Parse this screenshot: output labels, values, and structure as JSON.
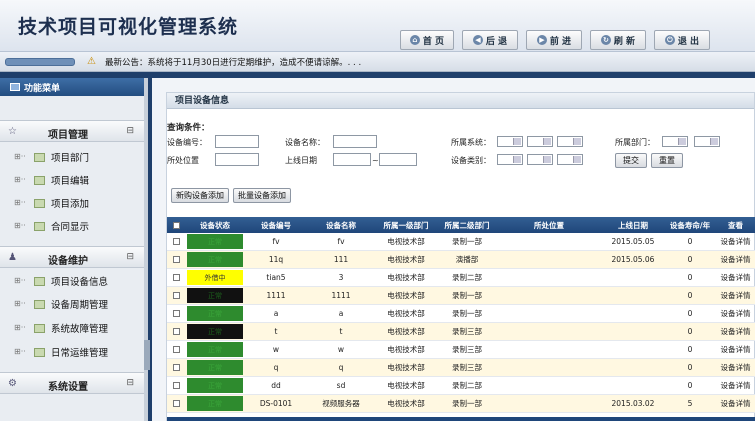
{
  "header": {
    "title": "技术项目可视化管理系统"
  },
  "nav": [
    {
      "label": "首 页",
      "icon": "home-icon",
      "glyph": "⌂"
    },
    {
      "label": "后 退",
      "icon": "back-icon",
      "glyph": "◀"
    },
    {
      "label": "前 进",
      "icon": "forward-icon",
      "glyph": "▶"
    },
    {
      "label": "刷 新",
      "icon": "refresh-icon",
      "glyph": "↻"
    },
    {
      "label": "退 出",
      "icon": "power-icon",
      "glyph": "⏻"
    }
  ],
  "notice": {
    "text": "最新公告：系统将于11月30日进行定期维护，造成不便请谅解。. . ."
  },
  "sidebar": {
    "header": "功能菜单",
    "sections": [
      {
        "title": "项目管理",
        "items": [
          "项目部门",
          "项目编辑",
          "项目添加",
          "合同显示"
        ]
      },
      {
        "title": "设备维护",
        "items": [
          "项目设备信息",
          "设备周期管理",
          "系统故障管理",
          "日常运维管理"
        ]
      },
      {
        "title": "系统设置",
        "items": []
      }
    ]
  },
  "panel": {
    "title": "项目设备信息"
  },
  "query": {
    "heading": "查询条件：",
    "labels": {
      "device_no": "设备编号：",
      "device_name": "设备名称：",
      "system": "所属系统：",
      "dept": "所属部门：",
      "location": "所处位置",
      "online_date": "上线日期",
      "category": "设备类别：",
      "range_sep": "~"
    },
    "submit": "提交",
    "reset": "重置",
    "add_device": "新购设备添加",
    "batch_add": "批量设备添加"
  },
  "table": {
    "columns": [
      "设备状态",
      "设备编号",
      "设备名称",
      "所属一级部门",
      "所属二级部门",
      "所处位置",
      "上线日期",
      "设备寿命/年",
      "查看"
    ],
    "rows": [
      {
        "status": "正常",
        "status_color": "#2e8b2e",
        "no": "fv",
        "name": "fv",
        "dept1": "电视技术部",
        "dept2": "录制一部",
        "location": "",
        "date": "2015.05.05",
        "life": "0",
        "view": "设备详情"
      },
      {
        "status": "正常",
        "status_color": "#2e8b2e",
        "no": "11q",
        "name": "111",
        "dept1": "电视技术部",
        "dept2": "演播部",
        "location": "",
        "date": "2015.05.06",
        "life": "0",
        "view": "设备详情"
      },
      {
        "status": "外借中",
        "status_color": "#ffff00",
        "no": "tian5",
        "name": "3",
        "dept1": "电视技术部",
        "dept2": "录制二部",
        "location": "",
        "date": "",
        "life": "0",
        "view": "设备详情"
      },
      {
        "status": "正常",
        "status_color": "#111111",
        "no": "1111",
        "name": "1111",
        "dept1": "电视技术部",
        "dept2": "录制一部",
        "location": "",
        "date": "",
        "life": "0",
        "view": "设备详情"
      },
      {
        "status": "正常",
        "status_color": "#2e8b2e",
        "no": "a",
        "name": "a",
        "dept1": "电视技术部",
        "dept2": "录制一部",
        "location": "",
        "date": "",
        "life": "0",
        "view": "设备详情"
      },
      {
        "status": "正常",
        "status_color": "#111111",
        "no": "t",
        "name": "t",
        "dept1": "电视技术部",
        "dept2": "录制三部",
        "location": "",
        "date": "",
        "life": "0",
        "view": "设备详情"
      },
      {
        "status": "正常",
        "status_color": "#2e8b2e",
        "no": "w",
        "name": "w",
        "dept1": "电视技术部",
        "dept2": "录制三部",
        "location": "",
        "date": "",
        "life": "0",
        "view": "设备详情"
      },
      {
        "status": "正常",
        "status_color": "#2e8b2e",
        "no": "q",
        "name": "q",
        "dept1": "电视技术部",
        "dept2": "录制三部",
        "location": "",
        "date": "",
        "life": "0",
        "view": "设备详情"
      },
      {
        "status": "正常",
        "status_color": "#2e8b2e",
        "no": "dd",
        "name": "sd",
        "dept1": "电视技术部",
        "dept2": "录制二部",
        "location": "",
        "date": "",
        "life": "0",
        "view": "设备详情"
      },
      {
        "status": "正常",
        "status_color": "#2e8b2e",
        "no": "DS-0101",
        "name": "视频服务器",
        "dept1": "电视技术部",
        "dept2": "录制一部",
        "location": "",
        "date": "2015.03.02",
        "life": "5",
        "view": "设备详情"
      }
    ]
  }
}
